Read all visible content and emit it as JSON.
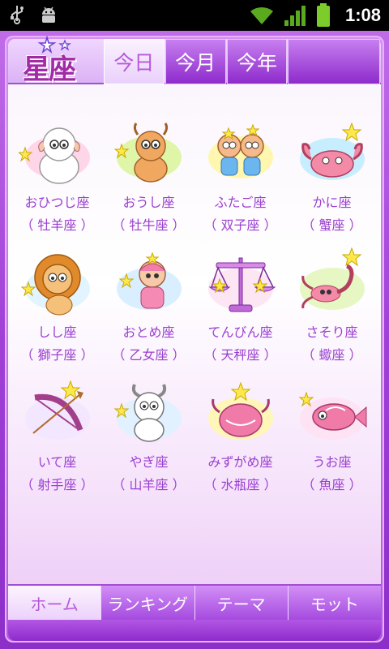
{
  "status_bar": {
    "time": "1:08",
    "icons": [
      "usb-icon",
      "android-debug-icon",
      "wifi-icon",
      "signal-icon",
      "battery-icon"
    ]
  },
  "header": {
    "logo_text": "星座",
    "tabs": [
      {
        "label": "今日",
        "active": true
      },
      {
        "label": "今月",
        "active": false
      },
      {
        "label": "今年",
        "active": false
      }
    ]
  },
  "signs": [
    {
      "name": "おひつじ座",
      "kanji": "（ 牡羊座 ）",
      "icon": "aries-ram-icon"
    },
    {
      "name": "おうし座",
      "kanji": "（ 牡牛座 ）",
      "icon": "taurus-bull-icon"
    },
    {
      "name": "ふたご座",
      "kanji": "（ 双子座 ）",
      "icon": "gemini-twins-icon"
    },
    {
      "name": "かに座",
      "kanji": "（ 蟹座 ）",
      "icon": "cancer-crab-icon"
    },
    {
      "name": "しし座",
      "kanji": "（ 獅子座 ）",
      "icon": "leo-lion-icon"
    },
    {
      "name": "おとめ座",
      "kanji": "（ 乙女座 ）",
      "icon": "virgo-girl-icon"
    },
    {
      "name": "てんびん座",
      "kanji": "（ 天秤座 ）",
      "icon": "libra-scales-icon"
    },
    {
      "name": "さそり座",
      "kanji": "（ 蠍座 ）",
      "icon": "scorpio-scorpion-icon"
    },
    {
      "name": "いて座",
      "kanji": "（ 射手座 ）",
      "icon": "sagittarius-bow-icon"
    },
    {
      "name": "やぎ座",
      "kanji": "（ 山羊座 ）",
      "icon": "capricorn-goat-icon"
    },
    {
      "name": "みずがめ座",
      "kanji": "（ 水瓶座 ）",
      "icon": "aquarius-jar-icon"
    },
    {
      "name": "うお座",
      "kanji": "（ 魚座 ）",
      "icon": "pisces-fish-icon"
    }
  ],
  "bottom_nav": [
    {
      "label": "ホーム",
      "active": true
    },
    {
      "label": "ランキング",
      "active": false
    },
    {
      "label": "テーマ",
      "active": false
    },
    {
      "label": "モット",
      "active": false
    }
  ],
  "colors": {
    "accent": "#a040d6",
    "label_text": "#9a3fd0",
    "active_tab_text": "#b55ad8"
  }
}
